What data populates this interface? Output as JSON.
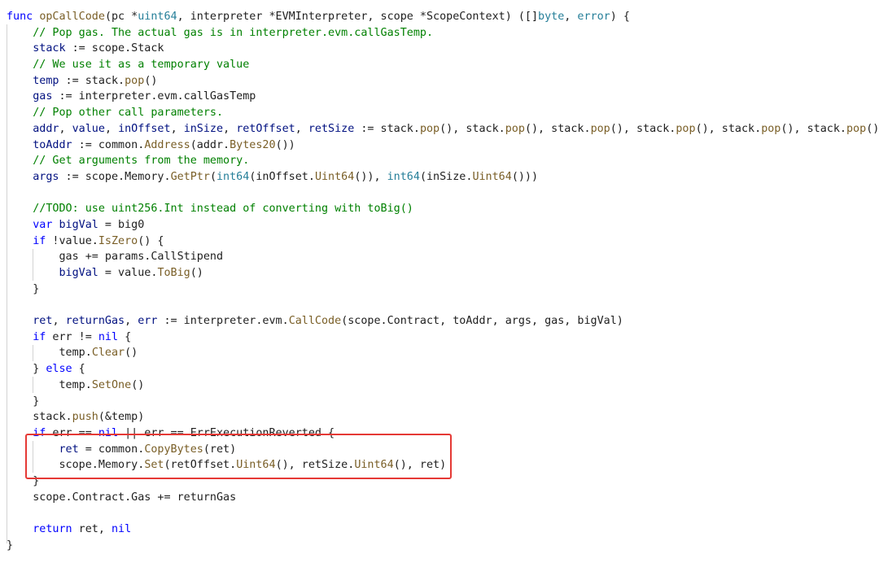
{
  "colors": {
    "keyword": "#0000ff",
    "type": "#267f99",
    "function": "#795e26",
    "variable": "#001080",
    "comment": "#008000",
    "plain": "#1e1e1e",
    "highlight_border": "#e53935"
  },
  "code_lines": [
    [
      [
        "kw",
        "func"
      ],
      [
        "p",
        " "
      ],
      [
        "fn",
        "opCallCode"
      ],
      [
        "p",
        "(pc *"
      ],
      [
        "typ",
        "uint64"
      ],
      [
        "p",
        ", interpreter *EVMInterpreter, scope *ScopeContext) ([]"
      ],
      [
        "typ",
        "byte"
      ],
      [
        "p",
        ", "
      ],
      [
        "typ",
        "error"
      ],
      [
        "p",
        ") {"
      ]
    ],
    [
      [
        "p",
        "    "
      ],
      [
        "com",
        "// Pop gas. The actual gas is in interpreter.evm.callGasTemp."
      ]
    ],
    [
      [
        "p",
        "    "
      ],
      [
        "var",
        "stack"
      ],
      [
        "p",
        " := scope.Stack"
      ]
    ],
    [
      [
        "p",
        "    "
      ],
      [
        "com",
        "// We use it as a temporary value"
      ]
    ],
    [
      [
        "p",
        "    "
      ],
      [
        "var",
        "temp"
      ],
      [
        "p",
        " := stack."
      ],
      [
        "fn",
        "pop"
      ],
      [
        "p",
        "()"
      ]
    ],
    [
      [
        "p",
        "    "
      ],
      [
        "var",
        "gas"
      ],
      [
        "p",
        " := interpreter.evm.callGasTemp"
      ]
    ],
    [
      [
        "p",
        "    "
      ],
      [
        "com",
        "// Pop other call parameters."
      ]
    ],
    [
      [
        "p",
        "    "
      ],
      [
        "var",
        "addr"
      ],
      [
        "p",
        ", "
      ],
      [
        "var",
        "value"
      ],
      [
        "p",
        ", "
      ],
      [
        "var",
        "inOffset"
      ],
      [
        "p",
        ", "
      ],
      [
        "var",
        "inSize"
      ],
      [
        "p",
        ", "
      ],
      [
        "var",
        "retOffset"
      ],
      [
        "p",
        ", "
      ],
      [
        "var",
        "retSize"
      ],
      [
        "p",
        " := stack."
      ],
      [
        "fn",
        "pop"
      ],
      [
        "p",
        "(), stack."
      ],
      [
        "fn",
        "pop"
      ],
      [
        "p",
        "(), stack."
      ],
      [
        "fn",
        "pop"
      ],
      [
        "p",
        "(), stack."
      ],
      [
        "fn",
        "pop"
      ],
      [
        "p",
        "(), stack."
      ],
      [
        "fn",
        "pop"
      ],
      [
        "p",
        "(), stack."
      ],
      [
        "fn",
        "pop"
      ],
      [
        "p",
        "()"
      ]
    ],
    [
      [
        "p",
        "    "
      ],
      [
        "var",
        "toAddr"
      ],
      [
        "p",
        " := common."
      ],
      [
        "fn",
        "Address"
      ],
      [
        "p",
        "(addr."
      ],
      [
        "fn",
        "Bytes20"
      ],
      [
        "p",
        "())"
      ]
    ],
    [
      [
        "p",
        "    "
      ],
      [
        "com",
        "// Get arguments from the memory."
      ]
    ],
    [
      [
        "p",
        "    "
      ],
      [
        "var",
        "args"
      ],
      [
        "p",
        " := scope.Memory."
      ],
      [
        "fn",
        "GetPtr"
      ],
      [
        "p",
        "("
      ],
      [
        "typ",
        "int64"
      ],
      [
        "p",
        "(inOffset."
      ],
      [
        "fn",
        "Uint64"
      ],
      [
        "p",
        "()), "
      ],
      [
        "typ",
        "int64"
      ],
      [
        "p",
        "(inSize."
      ],
      [
        "fn",
        "Uint64"
      ],
      [
        "p",
        "()))"
      ]
    ],
    [
      [
        "p",
        ""
      ]
    ],
    [
      [
        "p",
        "    "
      ],
      [
        "com",
        "//TODO: use uint256.Int instead of converting with toBig()"
      ]
    ],
    [
      [
        "p",
        "    "
      ],
      [
        "kw",
        "var"
      ],
      [
        "p",
        " "
      ],
      [
        "var",
        "bigVal"
      ],
      [
        "p",
        " = big0"
      ]
    ],
    [
      [
        "p",
        "    "
      ],
      [
        "kw",
        "if"
      ],
      [
        "p",
        " !value."
      ],
      [
        "fn",
        "IsZero"
      ],
      [
        "p",
        "() {"
      ]
    ],
    [
      [
        "p",
        "        gas += params.CallStipend"
      ]
    ],
    [
      [
        "p",
        "        "
      ],
      [
        "var",
        "bigVal"
      ],
      [
        "p",
        " = value."
      ],
      [
        "fn",
        "ToBig"
      ],
      [
        "p",
        "()"
      ]
    ],
    [
      [
        "p",
        "    }"
      ]
    ],
    [
      [
        "p",
        ""
      ]
    ],
    [
      [
        "p",
        "    "
      ],
      [
        "var",
        "ret"
      ],
      [
        "p",
        ", "
      ],
      [
        "var",
        "returnGas"
      ],
      [
        "p",
        ", "
      ],
      [
        "var",
        "err"
      ],
      [
        "p",
        " := interpreter.evm."
      ],
      [
        "fn",
        "CallCode"
      ],
      [
        "p",
        "(scope.Contract, toAddr, args, gas, bigVal)"
      ]
    ],
    [
      [
        "p",
        "    "
      ],
      [
        "kw",
        "if"
      ],
      [
        "p",
        " err != "
      ],
      [
        "kw",
        "nil"
      ],
      [
        "p",
        " {"
      ]
    ],
    [
      [
        "p",
        "        temp."
      ],
      [
        "fn",
        "Clear"
      ],
      [
        "p",
        "()"
      ]
    ],
    [
      [
        "p",
        "    } "
      ],
      [
        "kw",
        "else"
      ],
      [
        "p",
        " {"
      ]
    ],
    [
      [
        "p",
        "        temp."
      ],
      [
        "fn",
        "SetOne"
      ],
      [
        "p",
        "()"
      ]
    ],
    [
      [
        "p",
        "    }"
      ]
    ],
    [
      [
        "p",
        "    stack."
      ],
      [
        "fn",
        "push"
      ],
      [
        "p",
        "(&temp)"
      ]
    ],
    [
      [
        "p",
        "    "
      ],
      [
        "kw",
        "if"
      ],
      [
        "p",
        " err == "
      ],
      [
        "kw",
        "nil"
      ],
      [
        "p",
        " || err == ErrExecutionReverted {"
      ]
    ],
    [
      [
        "p",
        "        "
      ],
      [
        "var",
        "ret"
      ],
      [
        "p",
        " = common."
      ],
      [
        "fn",
        "CopyBytes"
      ],
      [
        "p",
        "(ret)"
      ]
    ],
    [
      [
        "p",
        "        scope.Memory."
      ],
      [
        "fn",
        "Set"
      ],
      [
        "p",
        "(retOffset."
      ],
      [
        "fn",
        "Uint64"
      ],
      [
        "p",
        "(), retSize."
      ],
      [
        "fn",
        "Uint64"
      ],
      [
        "p",
        "(), ret)"
      ]
    ],
    [
      [
        "p",
        "    }"
      ]
    ],
    [
      [
        "p",
        "    scope.Contract.Gas += returnGas"
      ]
    ],
    [
      [
        "p",
        ""
      ]
    ],
    [
      [
        "p",
        "    "
      ],
      [
        "kw",
        "return"
      ],
      [
        "p",
        " ret, "
      ],
      [
        "kw",
        "nil"
      ]
    ],
    [
      [
        "p",
        "}"
      ]
    ]
  ]
}
